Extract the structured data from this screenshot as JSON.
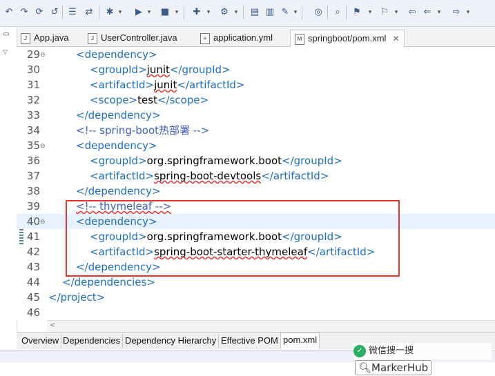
{
  "tabs": [
    {
      "label": "App.java",
      "icon": "java-file-icon"
    },
    {
      "label": "UserController.java",
      "icon": "java-file-icon"
    },
    {
      "label": "application.yml",
      "icon": "yml-file-icon"
    },
    {
      "label": "springboot/pom.xml",
      "icon": "pom-file-icon",
      "active": true
    }
  ],
  "close_glyph": "✕",
  "lines": [
    {
      "n": "29",
      "parts": [
        [
          "tg",
          "<dependency>"
        ]
      ],
      "fold": true
    },
    {
      "n": "30",
      "parts": [
        [
          "tg",
          "<groupId>"
        ],
        [
          "tx",
          "junit"
        ],
        [
          "tg",
          "</groupId>"
        ]
      ]
    },
    {
      "n": "31",
      "parts": [
        [
          "tg",
          "<artifactId>"
        ],
        [
          "tx",
          "junit"
        ],
        [
          "tg",
          "</artifactId>"
        ]
      ]
    },
    {
      "n": "32",
      "parts": [
        [
          "tg",
          "<scope>"
        ],
        [
          "tx",
          "test"
        ],
        [
          "tg",
          "</scope>"
        ]
      ]
    },
    {
      "n": "33",
      "parts": [
        [
          "tg",
          "</dependency>"
        ]
      ]
    },
    {
      "n": "34",
      "parts": [
        [
          "cm",
          "<!-- spring-boot热部署 -->"
        ]
      ]
    },
    {
      "n": "35",
      "parts": [
        [
          "tg",
          "<dependency>"
        ]
      ],
      "fold": true
    },
    {
      "n": "36",
      "parts": [
        [
          "tg",
          "<groupId>"
        ],
        [
          "tx",
          "org.springframework.boot"
        ],
        [
          "tg",
          "</groupId>"
        ]
      ]
    },
    {
      "n": "37",
      "parts": [
        [
          "tg",
          "<artifactId>"
        ],
        [
          "tx",
          "spring-boot-devtools"
        ],
        [
          "tg",
          "</artifactId>"
        ]
      ]
    },
    {
      "n": "38",
      "parts": [
        [
          "tg",
          "</dependency>"
        ]
      ]
    },
    {
      "n": "39",
      "parts": [
        [
          "cm",
          "<!-- thymeleaf -->"
        ]
      ]
    },
    {
      "n": "40",
      "parts": [
        [
          "tg",
          "<dependency>"
        ]
      ],
      "fold": true,
      "hl": true
    },
    {
      "n": "41",
      "parts": [
        [
          "tg",
          "<groupId>"
        ],
        [
          "tx",
          "org.springframework.boot"
        ],
        [
          "tg",
          "</groupId>"
        ]
      ]
    },
    {
      "n": "42",
      "parts": [
        [
          "tg",
          "<artifactId>"
        ],
        [
          "tx",
          "spring-boot-starter-thymeleaf"
        ],
        [
          "tg",
          "</artifactId>"
        ]
      ]
    },
    {
      "n": "43",
      "parts": [
        [
          "tg",
          "</dependency>"
        ]
      ]
    },
    {
      "n": "44",
      "parts": [
        [
          "tg",
          "</dependencies>"
        ]
      ]
    },
    {
      "n": "45",
      "parts": [
        [
          "tg",
          "</project>"
        ]
      ]
    },
    {
      "n": "46",
      "parts": []
    }
  ],
  "bottom_tabs": [
    "Overview",
    "Dependencies",
    "Dependency Hierarchy",
    "Effective POM",
    "pom.xml"
  ],
  "watermark": {
    "text": "微信搜一搜",
    "brand": "MarkerHub"
  },
  "colors": {
    "tag": "#1e6fbf",
    "comment": "#3f5fbf",
    "highlight_box": "#e2372f",
    "current_line": "#e8f2fe"
  }
}
